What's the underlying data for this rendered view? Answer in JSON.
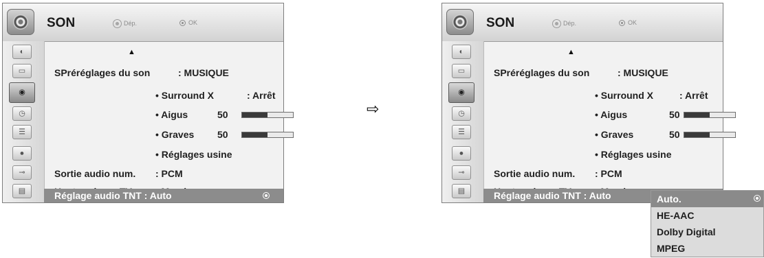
{
  "left_panel": {
    "title": "SON",
    "hint_move": "Dép.",
    "hint_ok": "OK",
    "sidebar_icons": [
      "satellite-dish-icon",
      "tv-screen-icon",
      "speaker-icon",
      "clock-icon",
      "lock-list-icon",
      "padlock-icon",
      "plug-icon",
      "clapper-icon"
    ],
    "sidebar_active_index": 2,
    "up_arrow": "▲",
    "rows": {
      "preset_label": "SPréréglages du son",
      "preset_value": ": MUSIQUE",
      "surround_label": "• Surround X",
      "surround_value": ": Arrêt",
      "treble_label": "• Aigus",
      "treble_value": "50",
      "bass_label": "• Graves",
      "bass_value": "50",
      "reset_label": "• Réglages usine",
      "digital_out_label": "Sortie audio num.",
      "digital_out_value": ": PCM",
      "tv_speaker_label": "Haut-parleurs TV",
      "tv_speaker_value": ": Marche",
      "dtv_audio_label": "Réglage audio TNT : Auto"
    },
    "treble_level": 0.5,
    "bass_level": 0.5
  },
  "right_panel": {
    "title": "SON",
    "hint_move": "Dép.",
    "hint_ok": "OK",
    "up_arrow": "▲",
    "rows": {
      "preset_label": "SPréréglages du son",
      "preset_value": ": MUSIQUE",
      "surround_label": "• Surround X",
      "surround_value": ": Arrêt",
      "treble_label": "• Aigus",
      "treble_value": "50",
      "bass_label": "• Graves",
      "bass_value": "50",
      "reset_label": "• Réglages usine",
      "digital_out_label": "Sortie audio num.",
      "digital_out_value": ": PCM",
      "tv_speaker_label": "Haut-parleurs TV",
      "tv_speaker_value": ": Marche",
      "dtv_audio_label": "Réglage audio TNT : Auto"
    },
    "treble_level": 0.5,
    "bass_level": 0.5
  },
  "transition_arrow": "⇨",
  "dropdown": {
    "options": [
      "Auto.",
      "HE-AAC",
      "Dolby Digital",
      "MPEG"
    ],
    "selected": "Auto."
  },
  "colors": {
    "selected_row": "#8c8c8c",
    "bar_fill": "#3a3a3a"
  }
}
